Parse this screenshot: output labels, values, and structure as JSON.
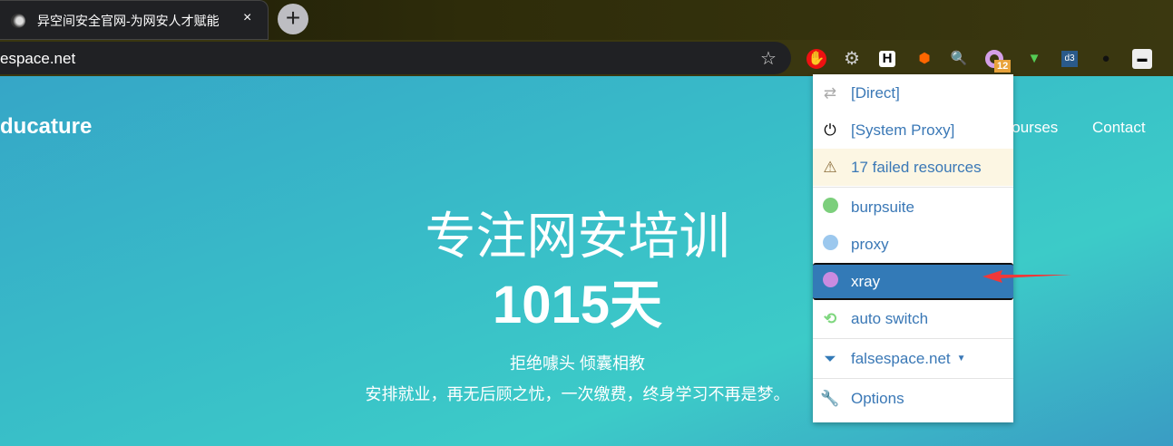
{
  "browser": {
    "tab_title": "异空间安全官网-为网安人才赋能",
    "url": "espace.net",
    "new_tab": "+",
    "close": "×",
    "star": "☆",
    "extension_badge": "12"
  },
  "site": {
    "brand": "ducature",
    "nav": [
      "Courses",
      "Contact"
    ],
    "headline": "专注网安培训",
    "days": "1015天",
    "tagline": "拒绝噱头 倾囊相教",
    "sub": "安排就业，再无后顾之忧，一次缴费，终身学习不再是梦。"
  },
  "menu": {
    "items": [
      {
        "label": "[Direct]",
        "icon": "swap-arrows-icon"
      },
      {
        "label": "[System Proxy]",
        "icon": "power-icon"
      },
      {
        "label": "17 failed resources",
        "icon": "warning-icon"
      },
      {
        "label": "burpsuite",
        "icon": "globe-icon",
        "color": "#7ccf7c"
      },
      {
        "label": "proxy",
        "icon": "globe-icon",
        "color": "#9cc8ee"
      },
      {
        "label": "xray",
        "icon": "globe-icon",
        "color": "#c98be0",
        "selected": true
      },
      {
        "label": "auto switch",
        "icon": "retweet-icon",
        "color": "#7fd77f"
      },
      {
        "label": "falsespace.net",
        "icon": "filter-icon"
      },
      {
        "label": "Options",
        "icon": "wrench-icon"
      }
    ]
  }
}
